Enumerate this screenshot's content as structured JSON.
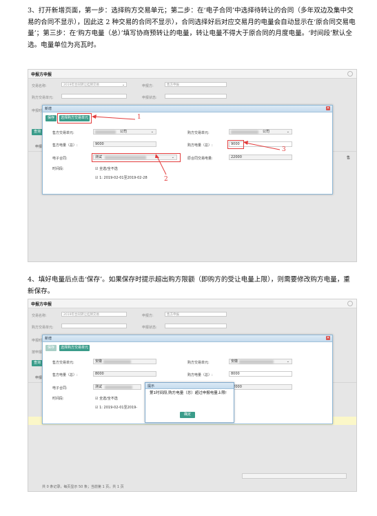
{
  "step3_text": "3、打开新增页面，第一步：选择购方交易单元；第二步：在‘电子合同’中选择待转让的合同（多年双边及集中交易的合同不显示），因此这 2 种交易的合同不显示），合同选择好后对应交易月的电量会自动显示在‘原合同交易电量’；第三步：在‘购方电量（总）’填写协商预转让的电量，转让电量不得大于原合同的月度电量。‘时间段’默认全选。电量单位为兆瓦时。",
  "step4_text": "4、填好电量后点击‘保存’。如果保存时提示超出购方限额（即购方的受让电量上限），则需要修改购方电量，重新保存。",
  "screenshot1": {
    "window_title": "申报方申报",
    "bg_labels": {
      "trade_name": "交易名称:",
      "trade_name_value": "2019年合同转让挂牌交易",
      "declarer": "申报方:",
      "declarer_value": "售方申报",
      "buyer_unit": "购方交易单元:",
      "declare_status": "申报状态:",
      "declare_time": "申报时间",
      "query": "查询",
      "declare_tab": "申报表"
    },
    "dialog_title": "新增",
    "save_button": "保存",
    "select_buyer_button": "选择购方交易单元",
    "seller_unit_label": "售方交易单元:",
    "seller_unit_value": "公司",
    "buyer_unit_label": "购方交易单元:",
    "buyer_unit_value": "公司",
    "seller_energy_label": "售方电量（总）:",
    "seller_energy_value": "9000",
    "buyer_energy_label": "购方电量（总）:",
    "buyer_energy_value": "9000",
    "contract_label": "电子合同:",
    "contract_value": "测试",
    "original_energy_label": "原合同交易电量:",
    "original_energy_value": "22000",
    "time_period_label": "时间段:",
    "select_all_label": "全选/全不选",
    "period_item": "1: 2019-02-01至2019-02-28",
    "annotation_1": "1",
    "annotation_2": "2",
    "annotation_3": "3",
    "right_col_label": "售"
  },
  "screenshot2": {
    "window_title": "申报方申报",
    "bg_labels": {
      "trade_name": "交易名称:",
      "trade_name_value": "2019年合同转让挂牌交易",
      "declarer": "申报方:",
      "declarer_value": "售方申报",
      "buyer_unit": "购方交易单元:",
      "declare_status": "申报状态:",
      "declare_time": "申报时间",
      "declare_person": "按申报人",
      "query": "查询",
      "declare_tab": "申报表"
    },
    "dialog_title": "新增",
    "save_button": "保存",
    "select_buyer_button": "选择购方交易单元",
    "seller_unit_label": "售方交易单元:",
    "seller_unit_value": "安徽",
    "buyer_unit_label": "购方交易单元:",
    "buyer_unit_value": "安徽",
    "seller_energy_label": "售方电量（总）:",
    "seller_energy_value": "8000",
    "buyer_energy_label": "购方电量（总）:",
    "buyer_energy_value": "8000",
    "contract_label": "电子合同:",
    "contract_value": "测试",
    "original_energy_value": "22000",
    "time_period_label": "时间段:",
    "select_all_label": "全选/全不选",
    "period_item": "1: 2019-02-01至2019-",
    "alert_title": "提示",
    "alert_message": "第1时间段,购方电量（总）超过申报电量上限!",
    "alert_ok": "确定",
    "footer_text": "共 0 条记录，每页显示 50 条；当前第 1 页，共 1 页"
  }
}
